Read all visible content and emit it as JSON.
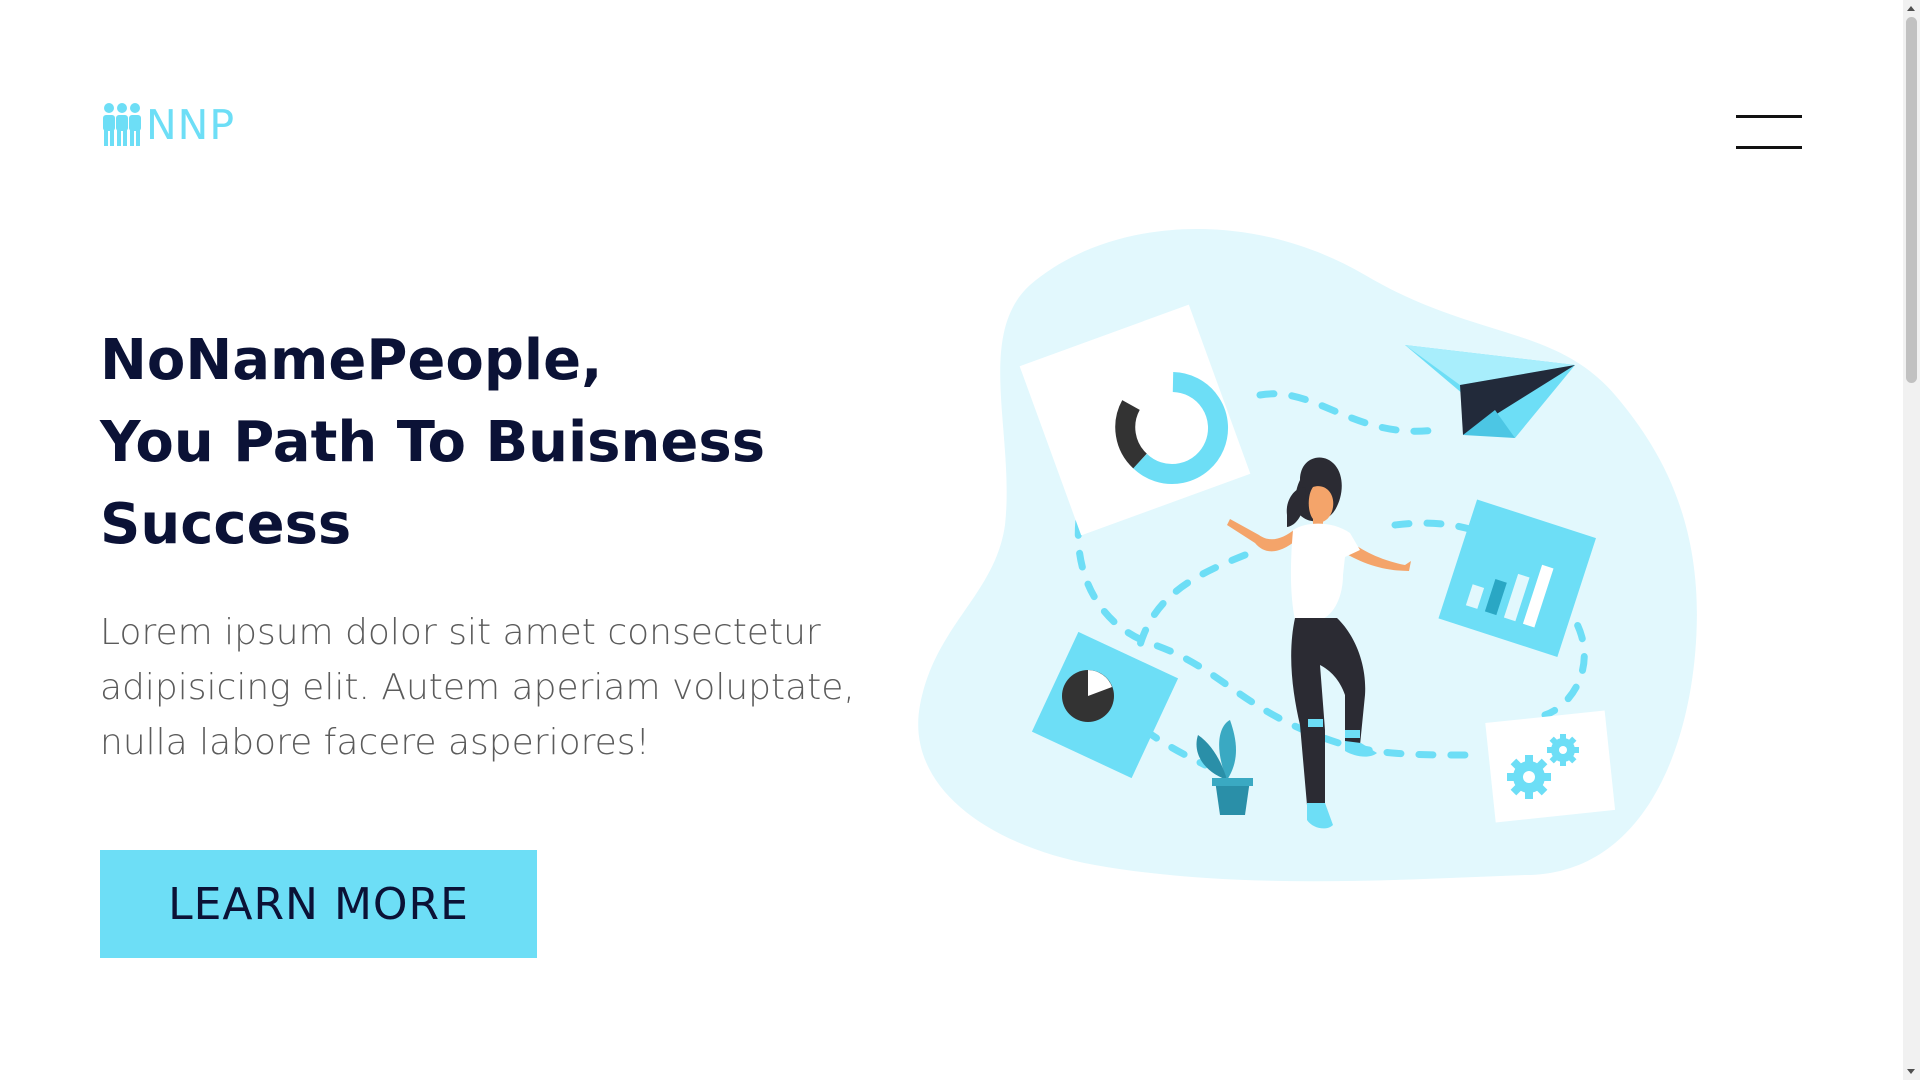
{
  "header": {
    "logo_text": "NNP",
    "logo_icon": "people-icon",
    "menu_icon": "hamburger-menu-icon"
  },
  "hero": {
    "headline_lines": [
      "NoNamePeople,",
      "You Path To Buisness",
      "Success"
    ],
    "description_lines": [
      "Lorem ipsum dolor sit amet consectetur",
      "adipisicing elit. Autem aperiam voluptate,",
      "nulla labore facere asperiores!"
    ],
    "cta_label": "LEARN MORE"
  },
  "colors": {
    "accent": "#6ddef6",
    "heading": "#0b1236",
    "body_text": "#5b5b5b",
    "blob": "#e2f8fd"
  }
}
